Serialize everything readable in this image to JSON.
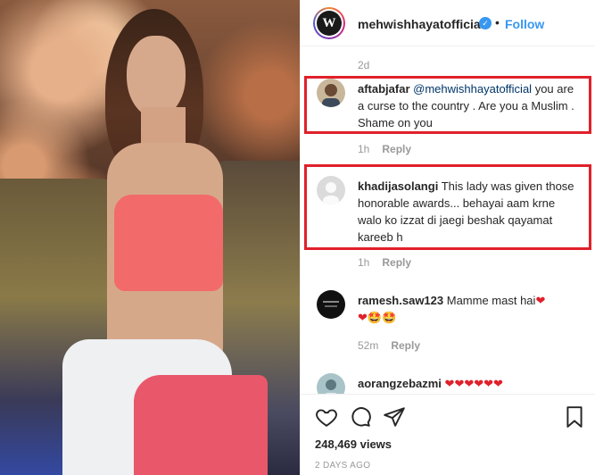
{
  "post": {
    "username": "mehwishhayatofficial",
    "avatar_letter": "W",
    "follow_label": "Follow",
    "separator": "•",
    "verified_mark": "✓",
    "top_time": "2d"
  },
  "comments": [
    {
      "user": "aftabjafar",
      "mention": "@mehwishhayatofficial",
      "text": " you are a curse to the country . Are you a Muslim . Shame on you",
      "time": "1h",
      "reply_label": "Reply",
      "highlighted": true
    },
    {
      "user": "khadijasolangi",
      "text": " This lady was given those honorable awards... behayai aam krne walo ko izzat di jaegi beshak qayamat kareeb h",
      "time": "1h",
      "reply_label": "Reply",
      "highlighted": true
    },
    {
      "user": "ramesh.saw123",
      "text": " Mamme mast hai",
      "emoji_line1": "❤",
      "emoji_line2": "❤🤩🤩",
      "time": "52m",
      "reply_label": "Reply",
      "highlighted": false
    },
    {
      "user": "aorangzebazmi",
      "emoji": "❤❤❤❤❤❤",
      "highlighted": false
    }
  ],
  "footer": {
    "views": "248,469 views",
    "date": "2 DAYS AGO",
    "icons": [
      "heart-icon",
      "comment-icon",
      "share-icon",
      "bookmark-icon"
    ]
  },
  "colors": {
    "accent": "#3897f0",
    "highlight_box": "#e0202a",
    "muted": "#999999"
  }
}
